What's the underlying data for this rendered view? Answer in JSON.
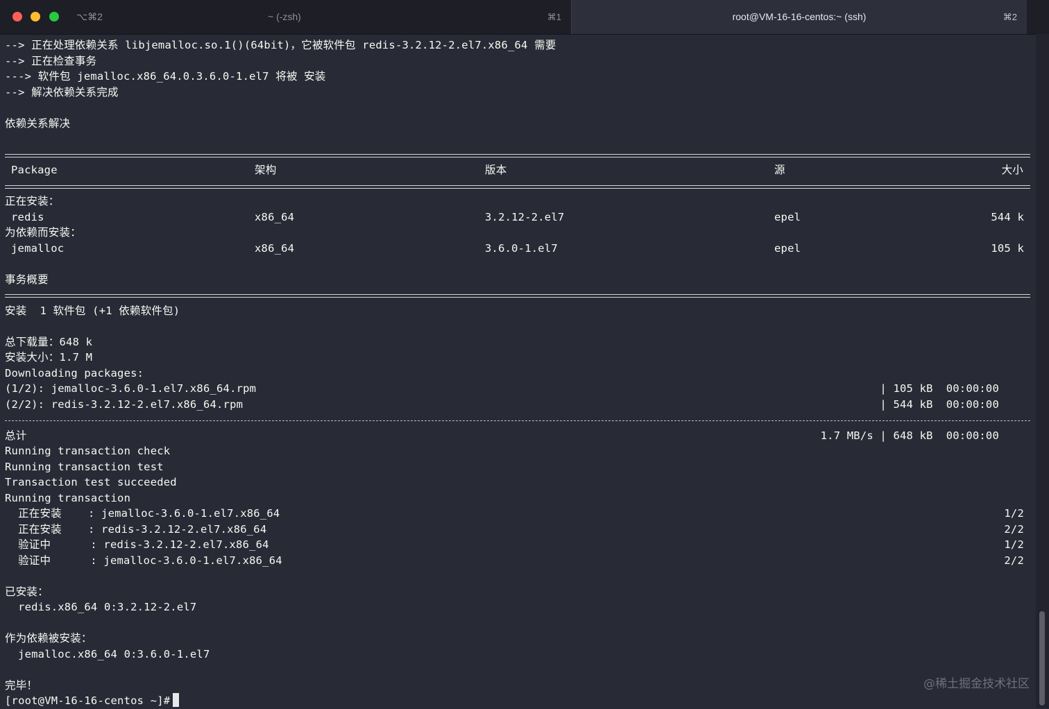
{
  "tabs": {
    "group_label": "⌥⌘2",
    "inactive": {
      "title": "~ (-zsh)",
      "shortcut": "⌘1"
    },
    "active": {
      "title": "root@VM-16-16-centos:~ (ssh)",
      "shortcut": "⌘2"
    }
  },
  "terminal": {
    "pre_lines": [
      "--> 正在处理依赖关系 libjemalloc.so.1()(64bit)，它被软件包 redis-3.2.12-2.el7.x86_64 需要",
      "--> 正在检查事务",
      "---> 软件包 jemalloc.x86_64.0.3.6.0-1.el7 将被 安装",
      "--> 解决依赖关系完成",
      "",
      "依赖关系解决",
      ""
    ],
    "table_header": {
      "package": "Package",
      "arch": "架构",
      "version": "版本",
      "repo": "源",
      "size": "大小"
    },
    "installing_label": "正在安装：",
    "rows": [
      {
        "package": "redis",
        "arch": "x86_64",
        "version": "3.2.12-2.el7",
        "repo": "epel",
        "size": "544 k"
      },
      {
        "package": "jemalloc",
        "arch": "x86_64",
        "version": "3.6.0-1.el7",
        "repo": "epel",
        "size": "105 k"
      }
    ],
    "dep_label": "为依赖而安装：",
    "summary_label": "事务概要",
    "install_summary": "安装  1 软件包 (+1 依赖软件包)",
    "total_download": "总下载量：648 k",
    "install_size": "安装大小：1.7 M",
    "downloading": "Downloading packages:",
    "downloads": [
      {
        "name": "(1/2): jemalloc-3.6.0-1.el7.x86_64.rpm",
        "stats": "| 105 kB  00:00:00"
      },
      {
        "name": "(2/2): redis-3.2.12-2.el7.x86_64.rpm",
        "stats": "| 544 kB  00:00:00"
      }
    ],
    "total_label": "总计",
    "total_stats": "1.7 MB/s | 648 kB  00:00:00",
    "run_lines": [
      "Running transaction check",
      "Running transaction test",
      "Transaction test succeeded",
      "Running transaction"
    ],
    "steps": [
      {
        "action": "  正在安装    : jemalloc-3.6.0-1.el7.x86_64",
        "count": "1/2"
      },
      {
        "action": "  正在安装    : redis-3.2.12-2.el7.x86_64",
        "count": "2/2"
      },
      {
        "action": "  验证中      : redis-3.2.12-2.el7.x86_64",
        "count": "1/2"
      },
      {
        "action": "  验证中      : jemalloc-3.6.0-1.el7.x86_64",
        "count": "2/2"
      }
    ],
    "installed_label": "已安装：",
    "installed_pkg": "  redis.x86_64 0:3.2.12-2.el7",
    "dep_installed_label": "作为依赖被安装：",
    "dep_installed_pkg": "  jemalloc.x86_64 0:3.6.0-1.el7",
    "done": "完毕！",
    "prompt": "[root@VM-16-16-centos ~]#"
  },
  "watermark": "@稀土掘金技术社区"
}
